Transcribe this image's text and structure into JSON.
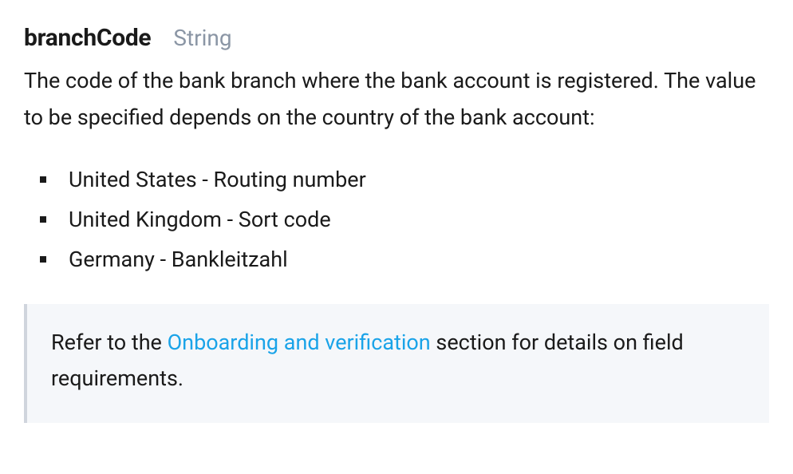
{
  "field": {
    "name": "branchCode",
    "type": "String",
    "description": "The code of the bank branch where the bank account is registered. The value to be specified depends on the country of the bank account:"
  },
  "bullets": [
    "United States - Routing number",
    "United Kingdom - Sort code",
    "Germany - Bankleitzahl"
  ],
  "note": {
    "prefix": "Refer to the ",
    "link_text": "Onboarding and verification",
    "suffix": " section for details on field requirements."
  }
}
